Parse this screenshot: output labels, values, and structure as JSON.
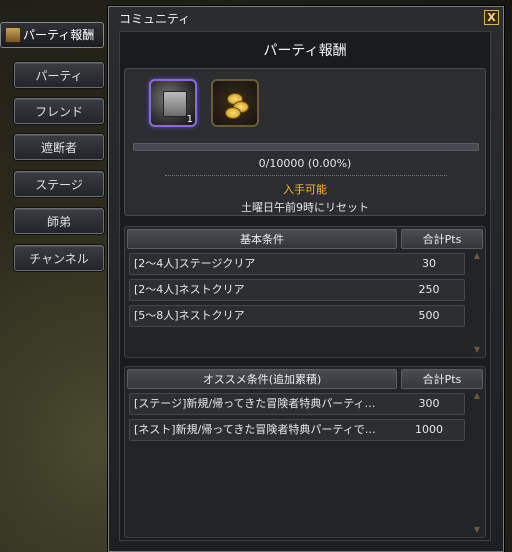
{
  "window": {
    "title": "コミュニティ",
    "close": "X"
  },
  "side_tabs": {
    "active": "パーティ報酬",
    "items": [
      "パーティ",
      "フレンド",
      "遮断者",
      "ステージ",
      "師弟",
      "チャンネル"
    ]
  },
  "panel": {
    "title": "パーティ報酬",
    "reward_count": "1",
    "progress": {
      "text": "0/10000 (0.00%)",
      "fraction": 0.0
    },
    "status": "入手可能",
    "reset": "土曜日午前9時にリセット"
  },
  "basic": {
    "header": "基本条件",
    "pts_header": "合計Pts",
    "rows": [
      {
        "name": "[2～4人]ステージクリア",
        "pts": "30"
      },
      {
        "name": "[2～4人]ネストクリア",
        "pts": "250"
      },
      {
        "name": "[5～8人]ネストクリア",
        "pts": "500"
      }
    ]
  },
  "recommend": {
    "header": "オススメ条件(追加累積)",
    "pts_header": "合計Pts",
    "rows": [
      {
        "name": "[ステージ]新規/帰ってきた冒険者特典パーティ…",
        "pts": "300"
      },
      {
        "name": "[ネスト]新規/帰ってきた冒険者特典パーティで…",
        "pts": "1000"
      }
    ]
  },
  "colors": {
    "accent": "#ffb52e",
    "border": "#7a7c80",
    "selected_icon_border": "#8a6cd8"
  }
}
